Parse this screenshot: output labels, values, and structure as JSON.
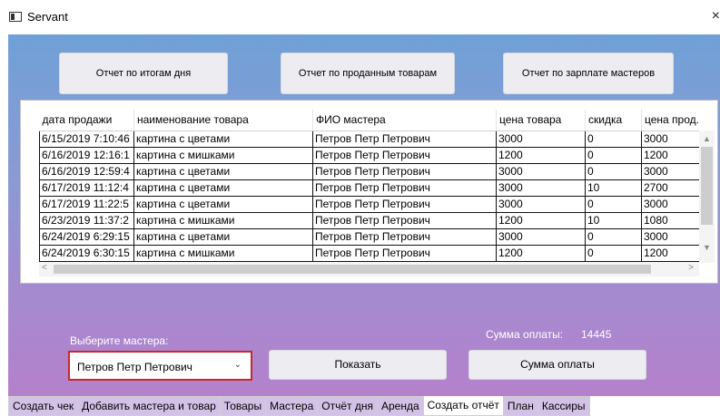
{
  "window": {
    "title": "Servant",
    "close_glyph": "×"
  },
  "top_buttons": {
    "daily_report": "Отчет по итогам дня",
    "sold_goods_report": "Отчет по проданным товарам",
    "salary_report": "Отчет по зарплате мастеров"
  },
  "grid": {
    "columns": [
      "дата продажи",
      "наименование товара",
      "ФИО мастера",
      "цена товара",
      "скидка",
      "цена прод."
    ],
    "rows": [
      [
        "6/15/2019 7:10:46",
        "картина с цветами",
        "Петров Петр Петрович",
        "3000",
        "0",
        "3000"
      ],
      [
        "6/16/2019 12:16:1",
        "картина с мишками",
        "Петров Петр Петрович",
        "1200",
        "0",
        "1200"
      ],
      [
        "6/16/2019 12:59:4",
        "картина с цветами",
        "Петров Петр Петрович",
        "3000",
        "0",
        "3000"
      ],
      [
        "6/17/2019 11:12:4",
        "картина с цветами",
        "Петров Петр Петрович",
        "3000",
        "10",
        "2700"
      ],
      [
        "6/17/2019 11:22:5",
        "картина с цветами",
        "Петров Петр Петрович",
        "3000",
        "0",
        "3000"
      ],
      [
        "6/23/2019 11:37:2",
        "картина с мишками",
        "Петров Петр Петрович",
        "1200",
        "10",
        "1080"
      ],
      [
        "6/24/2019 6:29:15",
        "картина с цветами",
        "Петров Петр Петрович",
        "3000",
        "0",
        "3000"
      ],
      [
        "6/24/2019 6:30:15",
        "картина с мишками",
        "Петров Петр Петрович",
        "1200",
        "0",
        "1200"
      ]
    ]
  },
  "controls": {
    "select_master_label": "Выберите мастера:",
    "selected_master": "Петров Петр Петрович",
    "payment_sum_label": "Сумма оплаты:",
    "payment_sum_value": "14445",
    "show_button": "Показать",
    "sum_button": "Сумма оплаты"
  },
  "tabs": [
    {
      "label": "Создать чек",
      "active": false
    },
    {
      "label": "Добавить мастера и товар",
      "active": false
    },
    {
      "label": "Товары",
      "active": false
    },
    {
      "label": "Мастера",
      "active": false
    },
    {
      "label": "Отчёт дня",
      "active": false
    },
    {
      "label": "Аренда",
      "active": false
    },
    {
      "label": "Создать отчёт",
      "active": true
    },
    {
      "label": "План",
      "active": false
    },
    {
      "label": "Кассиры",
      "active": false
    }
  ],
  "colors": {
    "gradient_top": "#6fa1d6",
    "gradient_bottom": "#b481cb",
    "select_border": "#c8282d",
    "tab_bg": "#d4c2e6"
  }
}
